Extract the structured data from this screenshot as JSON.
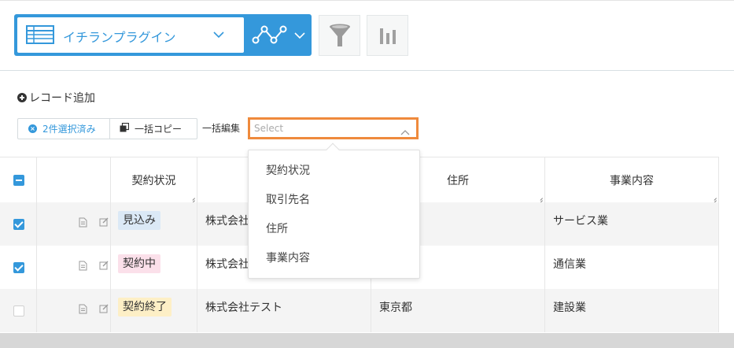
{
  "toolbar": {
    "view_name": "イチランプラグイン",
    "colors": {
      "accent": "#3498db",
      "highlight": "#ef8a3c"
    }
  },
  "actions": {
    "add_record": "レコード追加",
    "selected_count": "2件選択済み",
    "bulk_copy": "一括コピー",
    "bulk_edit_label": "一括編集",
    "bulk_select_placeholder": "Select"
  },
  "dropdown": {
    "options": [
      "契約状況",
      "取引先名",
      "住所",
      "事業内容"
    ]
  },
  "table": {
    "headers": [
      "契約状況",
      "",
      "住所",
      "事業内容"
    ],
    "rows": [
      {
        "checked": true,
        "status": "見込み",
        "status_color": "#dbe9f6",
        "company": "株式会社",
        "address": "",
        "business": "サービス業"
      },
      {
        "checked": true,
        "status": "契約中",
        "status_color": "#fbe0ea",
        "company": "株式会社",
        "address": "",
        "business": "通信業"
      },
      {
        "checked": false,
        "status": "契約終了",
        "status_color": "#fdefc6",
        "company": "株式会社テスト",
        "address": "東京都",
        "business": "建設業"
      }
    ]
  }
}
